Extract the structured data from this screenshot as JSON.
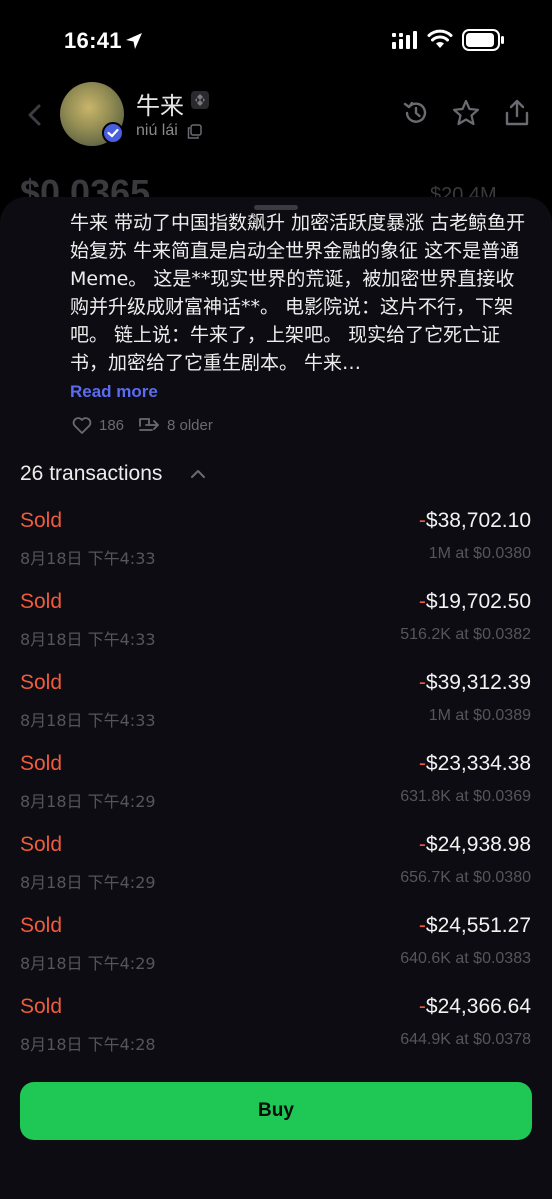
{
  "status_bar": {
    "time": "16:41"
  },
  "header": {
    "token_name": "牛来",
    "token_sub": "niú lái"
  },
  "peek": {
    "price": "$0.0365",
    "right": "$20.4M"
  },
  "post": {
    "text": "牛来 带动了中国指数飙升 加密活跃度暴涨 古老鲸鱼开始复苏 牛来简直是启动全世界金融的象征 这不是普通Meme。 这是**现实世界的荒诞，被加密世界直接收购并升级成财富神话**。 电影院说：这片不行，下架吧。 链上说：牛来了，上架吧。 现实给了它死亡证书，加密给了它重生剧本。 牛来…",
    "read_more": "Read more",
    "likes": "186",
    "older": "8 older"
  },
  "transactions": {
    "header": "26 transactions",
    "items": [
      {
        "type": "Sold",
        "sign": "-",
        "amount": "$38,702.10",
        "date": "8月18日 下午4:33",
        "detail": "1M at $0.0380"
      },
      {
        "type": "Sold",
        "sign": "-",
        "amount": "$19,702.50",
        "date": "8月18日 下午4:33",
        "detail": "516.2K at $0.0382"
      },
      {
        "type": "Sold",
        "sign": "-",
        "amount": "$39,312.39",
        "date": "8月18日 下午4:33",
        "detail": "1M at $0.0389"
      },
      {
        "type": "Sold",
        "sign": "-",
        "amount": "$23,334.38",
        "date": "8月18日 下午4:29",
        "detail": "631.8K at $0.0369"
      },
      {
        "type": "Sold",
        "sign": "-",
        "amount": "$24,938.98",
        "date": "8月18日 下午4:29",
        "detail": "656.7K at $0.0380"
      },
      {
        "type": "Sold",
        "sign": "-",
        "amount": "$24,551.27",
        "date": "8月18日 下午4:29",
        "detail": "640.6K at $0.0383"
      },
      {
        "type": "Sold",
        "sign": "-",
        "amount": "$24,366.64",
        "date": "8月18日 下午4:28",
        "detail": "644.9K at $0.0378"
      }
    ]
  },
  "buy_label": "Buy",
  "colors": {
    "sold": "#ef5b3c",
    "buy": "#1fc754",
    "link": "#5b6cf0"
  },
  "icons": [
    "location-arrow-icon",
    "signal-icon",
    "wifi-icon",
    "battery-icon",
    "back-chevron-icon",
    "verified-check-icon",
    "chain-icon",
    "copy-icon",
    "history-icon",
    "star-icon",
    "share-icon",
    "heart-icon",
    "repost-icon",
    "chevron-up-icon"
  ]
}
